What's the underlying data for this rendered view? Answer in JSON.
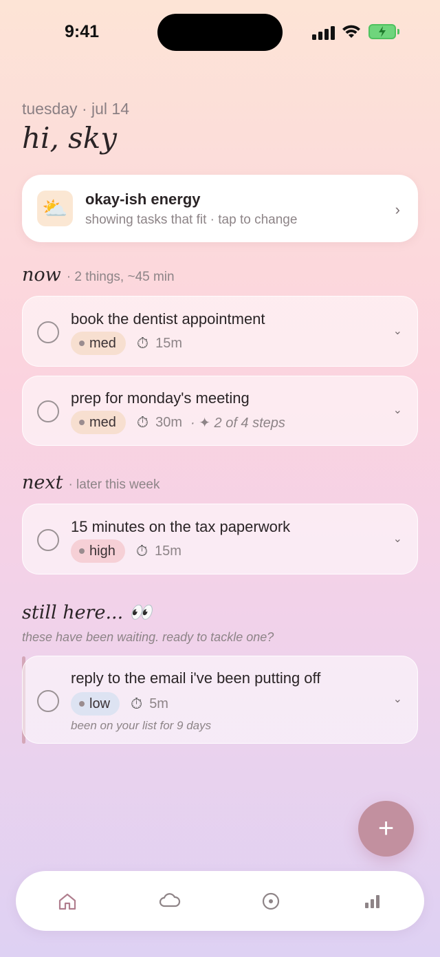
{
  "status": {
    "time": "9:41"
  },
  "header": {
    "date": "tuesday · jul 14",
    "greeting": "hi, sky"
  },
  "energy": {
    "emoji": "⛅",
    "title": "okay-ish energy",
    "subtitle": "showing tasks that fit · tap to change",
    "chevron": "›"
  },
  "sections": {
    "now": {
      "label": "now",
      "meta": "· 2 things, ~45 min"
    },
    "next": {
      "label": "next",
      "meta": "· later this week"
    },
    "still_here": {
      "label": "still here... 👀",
      "subtitle": "these have been waiting. ready to tackle one?"
    }
  },
  "tasks": [
    {
      "title": "book the dentist appointment",
      "energy": "med",
      "time": "15m",
      "steps": ""
    },
    {
      "title": "prep for monday's meeting",
      "energy": "med",
      "time": "30m",
      "steps": "· ✦ 2 of 4 steps"
    },
    {
      "title": "15 minutes on the tax paperwork",
      "energy": "high",
      "time": "15m",
      "steps": ""
    },
    {
      "title": "reply to the email i've been putting off",
      "energy": "low",
      "time": "5m",
      "note": "been on your list for 9 days"
    }
  ],
  "icons": {
    "stopwatch": "⏱",
    "chevron_down": "⌄",
    "fab": "+"
  },
  "tab_bar": [
    "home-icon",
    "cloud-icon",
    "focus-icon",
    "stats-icon"
  ],
  "colors": {
    "accent": "#c2909f",
    "med": "#f7dfd0",
    "high": "#f6d0d6",
    "low": "#dde3f2"
  }
}
